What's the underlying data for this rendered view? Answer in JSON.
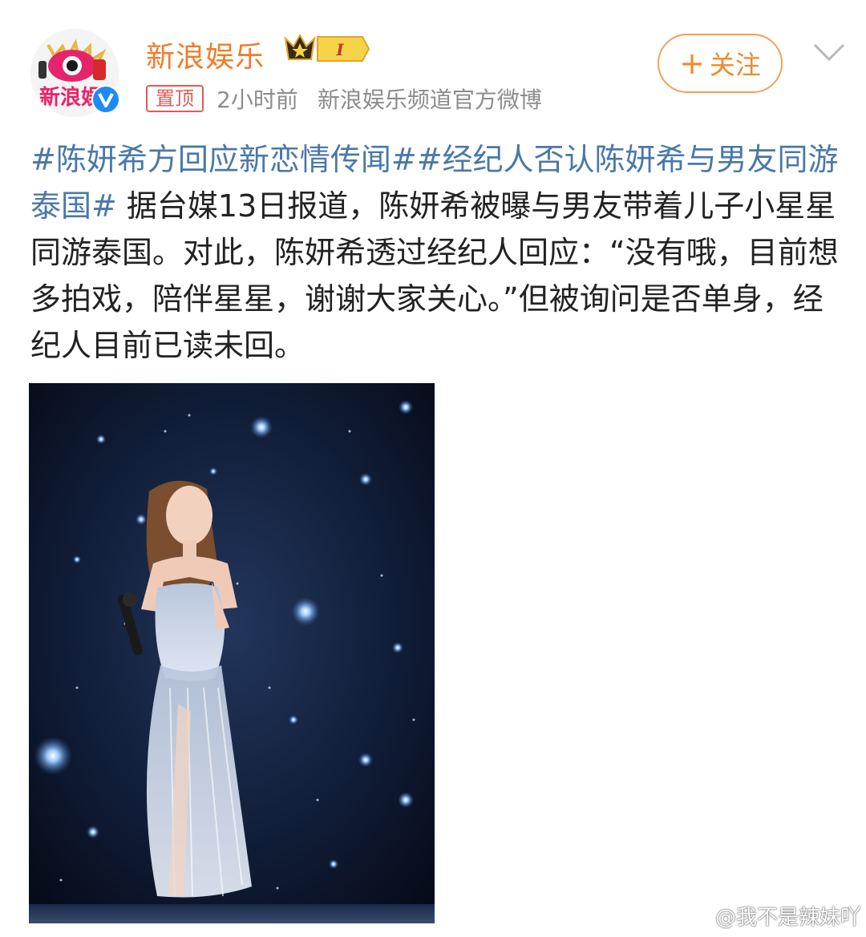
{
  "post": {
    "author": {
      "name": "新浪娱乐",
      "avatar_text": "新浪娱",
      "vip_badge": "I",
      "verified_icon": "verified-v-icon"
    },
    "pinned_label": "置顶",
    "time": "2小时前",
    "source": "新浪娱乐频道官方微博",
    "follow_label": "关注",
    "follow_plus": "+",
    "menu_icon": "chevron-down-icon",
    "tags": [
      "#陈妍希方回应新恋情传闻#",
      "#经纪人否认陈妍希与男友同游泰国#"
    ],
    "body": " 据台媒13日报道，陈妍希被曝与男友带着儿子小星星同游泰国。对此，陈妍希透过经纪人回应：“没有哦，目前想多拍戏，陪伴星星，谢谢大家关心。”但被询问是否单身，经纪人目前已读未回。"
  },
  "watermark": {
    "text": "@我不是辣妹吖",
    "icon": "weibo-logo-icon"
  },
  "colors": {
    "username": "#f07c28",
    "hashtag": "#4a78a8",
    "body_text": "#222222",
    "meta": "#8c8c8c",
    "pin": "#e15a5a",
    "follow_border": "#f3a252"
  }
}
